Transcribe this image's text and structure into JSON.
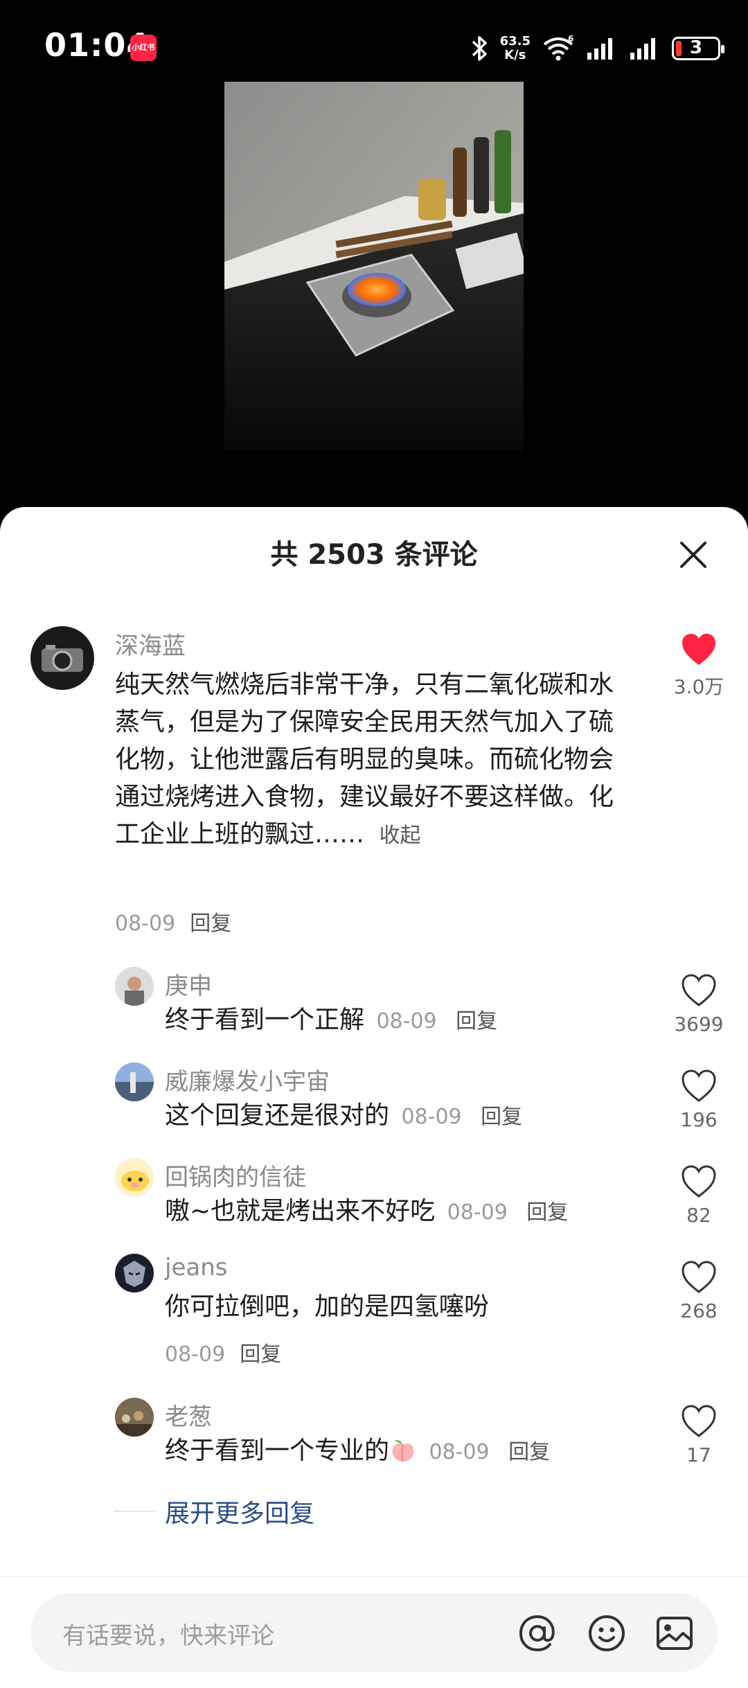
{
  "status": {
    "time": "01:04",
    "app_badge": "小红书",
    "net_speed": "63.5",
    "net_unit": "K/s",
    "battery": "3"
  },
  "sheet": {
    "title": "共 2503 条评论"
  },
  "main_comment": {
    "author": "深海蓝",
    "text": "纯天然气燃烧后非常干净，只有二氧化碳和水蒸气，但是为了保障安全民用天然气加入了硫化物，让他泄露后有明显的臭味。而硫化物会通过烧烤进入食物，建议最好不要这样做。化工企业上班的飘过……",
    "collapse_label": "收起",
    "date": "08-09",
    "reply_label": "回复",
    "likes": "3.0万"
  },
  "replies": [
    {
      "author": "庚申",
      "text": "终于看到一个正解",
      "date": "08-09",
      "reply_label": "回复",
      "likes": "3699"
    },
    {
      "author": "威廉爆发小宇宙",
      "text": "这个回复还是很对的",
      "date": "08-09",
      "reply_label": "回复",
      "likes": "196"
    },
    {
      "author": "回锅肉的信徒",
      "text": "嗷~也就是烤出来不好吃",
      "date": "08-09",
      "reply_label": "回复",
      "likes": "82"
    },
    {
      "author": "jeans",
      "text": "你可拉倒吧，加的是四氢噻吩",
      "date": "08-09",
      "reply_label": "回复",
      "likes": "268"
    },
    {
      "author": "老葱",
      "text": "终于看到一个专业的",
      "date": "08-09",
      "reply_label": "回复",
      "likes": "17"
    }
  ],
  "expand_more": "展开更多回复",
  "input": {
    "placeholder": "有话要说，快来评论"
  },
  "colors": {
    "accent_like": "#ff2442",
    "link": "#2b4d86"
  }
}
